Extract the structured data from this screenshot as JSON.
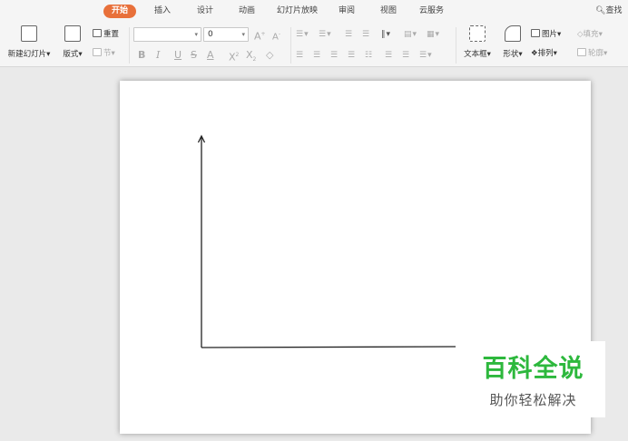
{
  "tabs": [
    {
      "label": "开始",
      "active": true
    },
    {
      "label": "插入"
    },
    {
      "label": "设计"
    },
    {
      "label": "动画"
    },
    {
      "label": "幻灯片放映"
    },
    {
      "label": "审阅"
    },
    {
      "label": "视图"
    },
    {
      "label": "云服务"
    }
  ],
  "find": {
    "label": "查找",
    "icon": "search-icon"
  },
  "ribbon": {
    "new_slide": "新建幻灯片",
    "layout": "版式",
    "reset": "重置",
    "section": "节",
    "font_name_value": "",
    "font_size_value": "0",
    "grow_font": "A",
    "shrink_font": "A",
    "bold": "B",
    "italic": "I",
    "underline": "U",
    "strike": "S",
    "font_color": "A",
    "superscript": "X",
    "subscript": "X",
    "textbox": "文本框",
    "shape": "形状",
    "picture": "图片",
    "arrange": "排列",
    "fill": "填充",
    "outline": "轮廓"
  },
  "watermark": {
    "title": "百科全说",
    "subtitle": "助你轻松解决"
  },
  "colors": {
    "accent": "#e8703a",
    "watermark_green": "#2db83d"
  }
}
